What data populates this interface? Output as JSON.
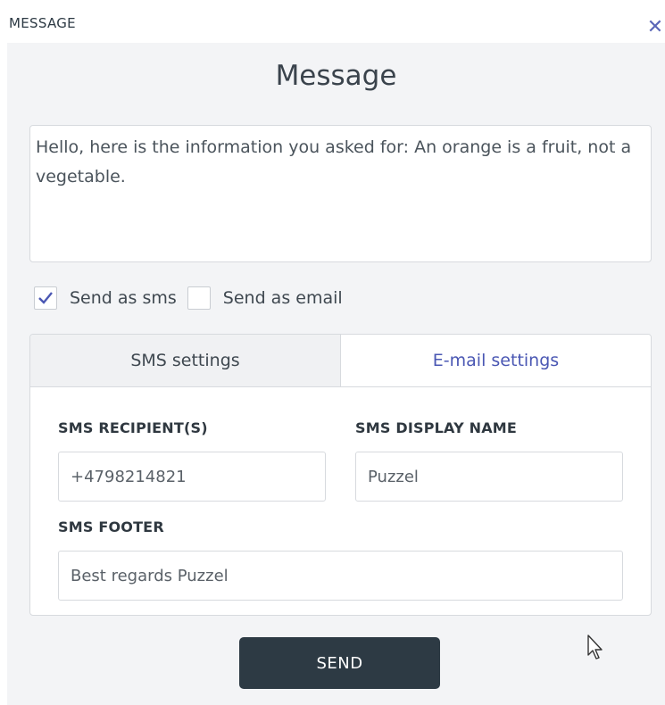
{
  "window": {
    "tab_label": "MESSAGE",
    "close_symbol": "✕"
  },
  "dialog": {
    "title": "Message",
    "message_text": "Hello, here is the information you asked for: An orange is a fruit, not a vegetable."
  },
  "options": {
    "sms": {
      "label": "Send as sms",
      "checked": true
    },
    "email": {
      "label": "Send as email",
      "checked": false
    }
  },
  "settings": {
    "tabs": [
      {
        "label": "SMS settings",
        "active": true
      },
      {
        "label": "E-mail settings",
        "active": false
      }
    ],
    "fields": {
      "recipients": {
        "label": "SMS RECIPIENT(S)",
        "value": "+4798214821"
      },
      "display_name": {
        "label": "SMS DISPLAY NAME",
        "value": "Puzzel"
      },
      "footer": {
        "label": "SMS FOOTER",
        "value": "Best regards Puzzel"
      }
    }
  },
  "actions": {
    "send_label": "SEND"
  },
  "colors": {
    "accent": "#4a57b3",
    "button_bg": "#2d3a44",
    "panel_bg": "#f3f4f6"
  }
}
